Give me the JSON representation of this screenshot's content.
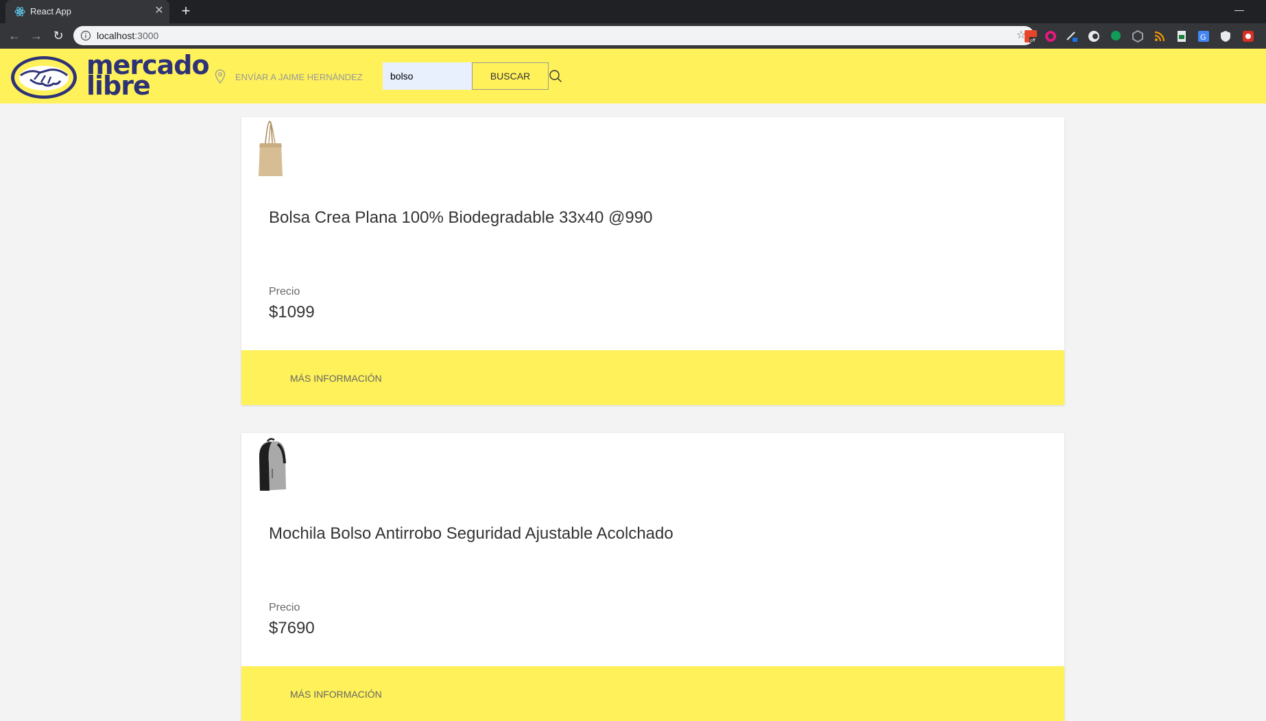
{
  "browser": {
    "tab_title": "React App",
    "url_host": "localhost",
    "url_port": ":3000"
  },
  "header": {
    "logo_line1": "mercado",
    "logo_line2": "libre",
    "ship_to": "ENVÍAR A JAIME HERNÁNDEZ",
    "search_value": "bolso",
    "search_button": "BUSCAR"
  },
  "products": [
    {
      "title": "Bolsa Crea Plana 100% Biodegradable 33x40 @990",
      "price_label": "Precio",
      "price": "$1099",
      "more_info": "MÁS INFORMACIÓN"
    },
    {
      "title": "Mochila Bolso Antirrobo Seguridad Ajustable Acolchado",
      "price_label": "Precio",
      "price": "$7690",
      "more_info": "MÁS INFORMACIÓN"
    }
  ],
  "colors": {
    "header_bg": "#fff159",
    "logo_blue": "#2d3277",
    "page_bg": "#f3f3f3"
  }
}
